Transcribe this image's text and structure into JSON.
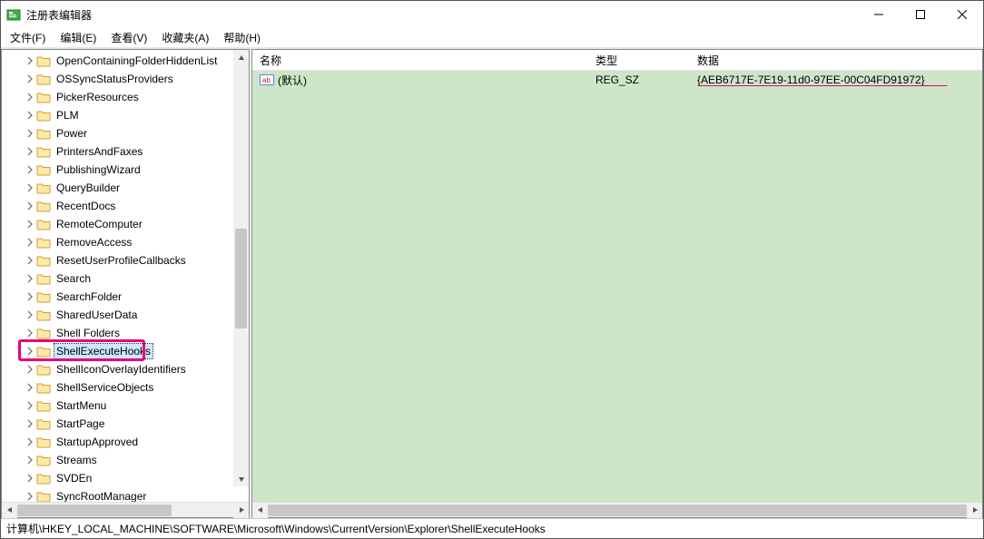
{
  "window": {
    "title": "注册表编辑器"
  },
  "menu": {
    "file": "文件(F)",
    "edit": "编辑(E)",
    "view": "查看(V)",
    "favorites": "收藏夹(A)",
    "help": "帮助(H)"
  },
  "tree": {
    "items": [
      {
        "label": "OpenContainingFolderHiddenList"
      },
      {
        "label": "OSSyncStatusProviders"
      },
      {
        "label": "PickerResources"
      },
      {
        "label": "PLM"
      },
      {
        "label": "Power"
      },
      {
        "label": "PrintersAndFaxes"
      },
      {
        "label": "PublishingWizard"
      },
      {
        "label": "QueryBuilder"
      },
      {
        "label": "RecentDocs"
      },
      {
        "label": "RemoteComputer"
      },
      {
        "label": "RemoveAccess"
      },
      {
        "label": "ResetUserProfileCallbacks"
      },
      {
        "label": "Search"
      },
      {
        "label": "SearchFolder"
      },
      {
        "label": "SharedUserData"
      },
      {
        "label": "Shell Folders"
      },
      {
        "label": "ShellExecuteHooks"
      },
      {
        "label": "ShellIconOverlayIdentifiers"
      },
      {
        "label": "ShellServiceObjects"
      },
      {
        "label": "StartMenu"
      },
      {
        "label": "StartPage"
      },
      {
        "label": "StartupApproved"
      },
      {
        "label": "Streams"
      },
      {
        "label": "SVDEn"
      },
      {
        "label": "SyncRootManager"
      }
    ],
    "selected_index": 16
  },
  "columns": {
    "name": "名称",
    "type": "类型",
    "data": "数据"
  },
  "values": [
    {
      "name": "(默认)",
      "type": "REG_SZ",
      "data": "{AEB6717E-7E19-11d0-97EE-00C04FD91972}"
    }
  ],
  "statusbar": {
    "path": "计算机\\HKEY_LOCAL_MACHINE\\SOFTWARE\\Microsoft\\Windows\\CurrentVersion\\Explorer\\ShellExecuteHooks"
  }
}
